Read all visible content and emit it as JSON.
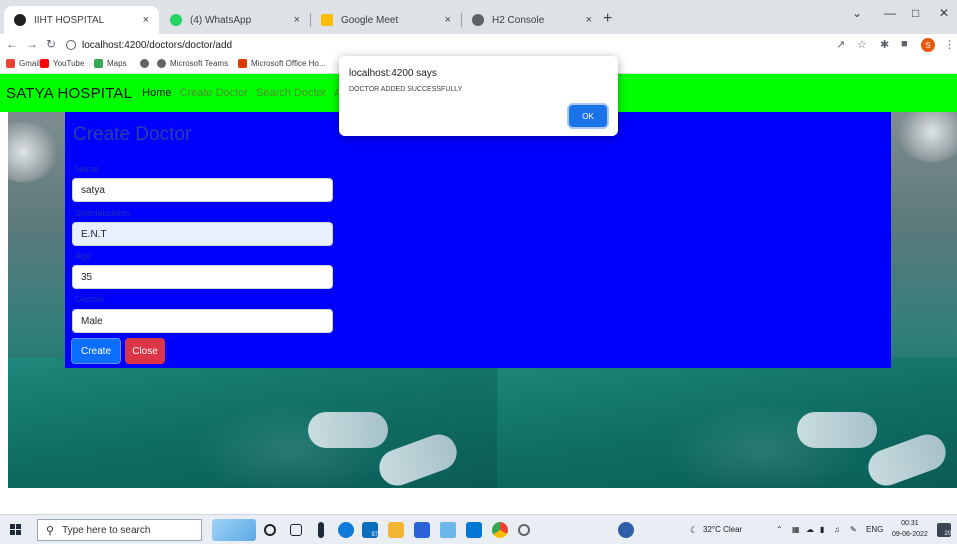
{
  "browser": {
    "tabs": [
      {
        "label": "IIHT HOSPITAL",
        "favicon": "hospital-favicon-icon"
      },
      {
        "label": "(4) WhatsApp",
        "favicon": "whatsapp-icon"
      },
      {
        "label": "Google Meet",
        "favicon": "google-meet-icon"
      },
      {
        "label": "H2 Console",
        "favicon": "globe-icon"
      }
    ],
    "close_glyph": "×",
    "new_tab_glyph": "+",
    "url": "localhost:4200/doctors/doctor/add",
    "bookmarks": [
      {
        "label": "Gmail"
      },
      {
        "label": "YouTube"
      },
      {
        "label": "Maps"
      },
      {
        "label": ""
      },
      {
        "label": "Microsoft Teams"
      },
      {
        "label": "Microsoft Office Ho..."
      }
    ],
    "profile_initial": "S"
  },
  "navbar": {
    "brand": "SATYA  HOSPITAL",
    "links": [
      "Home",
      "Create Doctor",
      "Search Doctor",
      "Adm"
    ],
    "bg_color": "#00ff00"
  },
  "form": {
    "title": "Create Doctor",
    "fields": [
      {
        "label": "Name",
        "value": "satya"
      },
      {
        "label": "Specialization",
        "value": "E.N.T"
      },
      {
        "label": "Age",
        "value": "35"
      },
      {
        "label": "Gender",
        "value": "Male"
      }
    ],
    "create_label": "Create",
    "close_label": "Close",
    "panel_color": "#0000ff"
  },
  "dialog": {
    "title": "localhost:4200 says",
    "message": "DOCTOR ADDED SUCCESSFULLY",
    "ok_label": "OK"
  },
  "taskbar": {
    "search_placeholder": "Type here to search",
    "edge_badge": "97",
    "weather": "32°C  Clear",
    "lang": "ENG",
    "time": "00:31",
    "date": "09-06-2022",
    "notification_count": "20"
  }
}
